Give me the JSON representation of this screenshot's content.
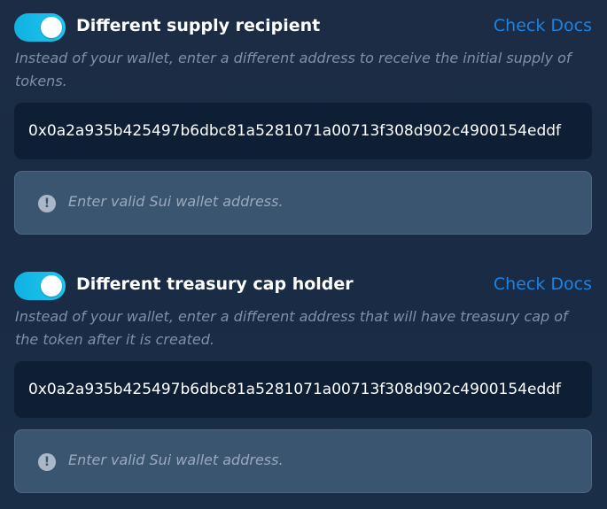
{
  "sections": [
    {
      "toggle_on": true,
      "title": "Different supply recipient",
      "docs_label": "Check Docs",
      "description": "Instead of your wallet, enter a different address to receive the initial supply of tokens.",
      "address_value": "0x0a2a935b425497b6dbc81a5281071a00713f308d902c4900154eddf",
      "alert_icon": "exclamation-circle-icon",
      "alert_text": "Enter valid Sui wallet address."
    },
    {
      "toggle_on": true,
      "title": "Different treasury cap holder",
      "docs_label": "Check Docs",
      "description": "Instead of your wallet, enter a different address that will have treasury cap of the token after it is created.",
      "address_value": "0x0a2a935b425497b6dbc81a5281071a00713f308d902c4900154eddf",
      "alert_icon": "exclamation-circle-icon",
      "alert_text": "Enter valid Sui wallet address."
    }
  ],
  "colors": {
    "toggle_accent": "#1fc7f0",
    "link": "#1a83e6",
    "input_bg": "#0e1e34",
    "alert_bg": "#3a5570"
  }
}
